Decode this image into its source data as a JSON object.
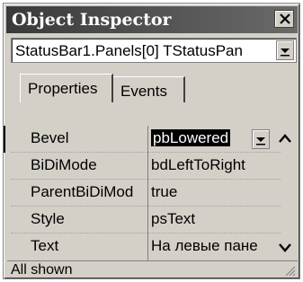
{
  "window": {
    "title": "Object Inspector"
  },
  "object_selector": {
    "value": "StatusBar1.Panels[0] TStatusPan"
  },
  "tabs": [
    {
      "label": "Properties",
      "active": true
    },
    {
      "label": "Events",
      "active": false
    }
  ],
  "properties": [
    {
      "name": "Bevel",
      "value": "pbLowered",
      "selected": true
    },
    {
      "name": "BiDiMode",
      "value": "bdLeftToRight",
      "selected": false
    },
    {
      "name": "ParentBiDiMod",
      "value": "true",
      "selected": false
    },
    {
      "name": "Style",
      "value": "psText",
      "selected": false
    },
    {
      "name": "Text",
      "value": "На левые пане",
      "selected": false
    }
  ],
  "status_bar": {
    "text": "All shown"
  }
}
